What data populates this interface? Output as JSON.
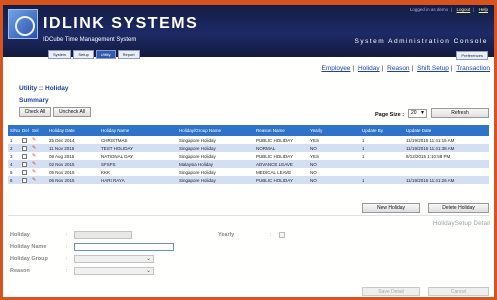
{
  "header": {
    "brand": "IDLINK SYSTEMS",
    "subtitle": "IDCube Time Management System",
    "console": "System Administration Console",
    "login_text": "Logged in as demo",
    "logout": "Logout",
    "help": "Help",
    "preferences": "Preferences"
  },
  "topnav": [
    "System",
    "Setup",
    "Utility",
    "Report"
  ],
  "sublinks": [
    "Employee",
    "Holiday",
    "Reason",
    "Shift Setup",
    "Transaction"
  ],
  "breadcrumb": "Utility :: Holiday",
  "summary": "Summary",
  "buttons": {
    "check_all": "Check All",
    "uncheck_all": "Uncheck All",
    "refresh": "Refresh",
    "new_holiday": "New Holiday",
    "delete_holiday": "Delete Holiday",
    "save_detail": "Save Detail",
    "cancel": "Cancel"
  },
  "page_size": {
    "label": "Page Size :",
    "value": "20"
  },
  "table": {
    "columns": [
      "S/No",
      "Del",
      "Sel",
      "Holiday Date",
      "Holiday Name",
      "Holiday/Group Name",
      "Reason Name",
      "Yearly",
      "Update By",
      "Update Date"
    ],
    "rows": [
      [
        "1",
        "25 Dec 2014",
        "CHRISTMAS",
        "Singapore Holiday",
        "PUBLIC HOLIDAY",
        "YES",
        "1",
        "11/19/2015 11:41:15 AM"
      ],
      [
        "2",
        "11 Nov 2015",
        "TEST HOLIDAY",
        "Singapore Holiday",
        "NORMAL",
        "NO",
        "1",
        "11/19/2015 11:41:38 AM"
      ],
      [
        "3",
        "09 Aug 2015",
        "NATIONAL DAY",
        "Singapore Holiday",
        "PUBLIC HOLIDAY",
        "YES",
        "1",
        "8/12/2015 1:10:58 PM"
      ],
      [
        "4",
        "02 Nov 2015",
        "SFSFS",
        "Malaysia Holiday",
        "ADVANCE LEAVE",
        "NO",
        "",
        ""
      ],
      [
        "5",
        "05 Nov 2015",
        "KKK",
        "Singapore Holiday",
        "MEDICAL LEAVE",
        "NO",
        "",
        ""
      ],
      [
        "6",
        "06 Nov 2015",
        "HARI RAYA",
        "Singapore Holiday",
        "PUBLIC HOLIDAY",
        "NO",
        "1",
        "11/19/2015 11:41:26 AM"
      ]
    ]
  },
  "detail": {
    "title": "HolidaySetup Detail",
    "holiday_label": "Holiday",
    "yearly_label": "Yearly",
    "holiday_name_label": "Holiday Name",
    "holiday_group_label": "Holiday Group",
    "reason_label": "Reason"
  },
  "colors": {
    "header_bg": "#1d2a66",
    "table_header": "#2f73c9",
    "row_alt": "#d4e0f2",
    "frame": "#d9531e"
  }
}
